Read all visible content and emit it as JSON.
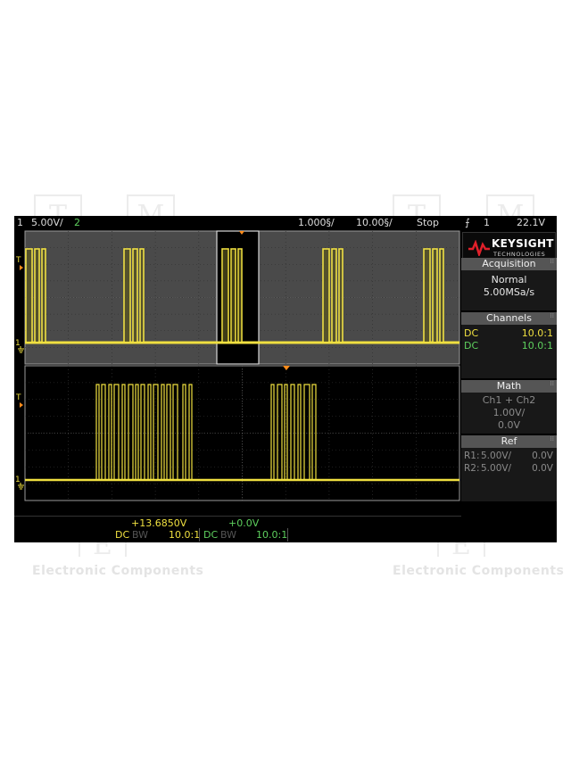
{
  "watermark": {
    "text_left": "Electronic Components",
    "text_right": "Electronic Components",
    "glyphs": [
      "T",
      "M",
      "T",
      "M",
      "E",
      "E"
    ]
  },
  "topbar": {
    "ch1_num": "1",
    "ch1_scale": "5.00V/",
    "ch2_num": "2",
    "timebase_delay": "1.000§/",
    "timebase_scale": "10.00§/",
    "run_state": "Stop",
    "trigger_icon": "⨍",
    "trigger_source": "1",
    "trigger_level": "22.1V"
  },
  "colors": {
    "ch1": "#f0e040",
    "ch2": "#5ed05e",
    "grid": "#3a3a3a",
    "panel_header": "#555555",
    "background": "#000000"
  },
  "brand": {
    "name": "KEYSIGHT",
    "sub": "TECHNOLOGIES",
    "logo_icon": "keysight-wave-icon"
  },
  "acquisition": {
    "title": "Acquisition",
    "mode": "Normal",
    "rate": "5.00MSa/s"
  },
  "channels": {
    "title": "Channels",
    "rows": [
      {
        "coupling": "DC",
        "probe": "10.0:1"
      },
      {
        "coupling": "DC",
        "probe": "10.0:1"
      }
    ]
  },
  "math": {
    "title": "Math",
    "function": "Ch1 + Ch2",
    "scale": "1.00V/",
    "offset": "0.0V"
  },
  "ref": {
    "title": "Ref",
    "rows": [
      {
        "name": "R1:",
        "scale": "5.00V/",
        "offset": "0.0V"
      },
      {
        "name": "R2:",
        "scale": "5.00V/",
        "offset": "0.0V"
      }
    ]
  },
  "markers": {
    "trigger_T": "T",
    "ground_1": "1"
  },
  "bottom": {
    "ch1_offset": "+13.6850V",
    "ch2_offset": "+0.0V",
    "ch1_coupling": "DC",
    "ch1_bw": "BW",
    "ch1_probe": "10.0:1",
    "ch2_coupling": "DC",
    "ch2_bw": "BW",
    "ch2_probe": "10.0:1"
  }
}
